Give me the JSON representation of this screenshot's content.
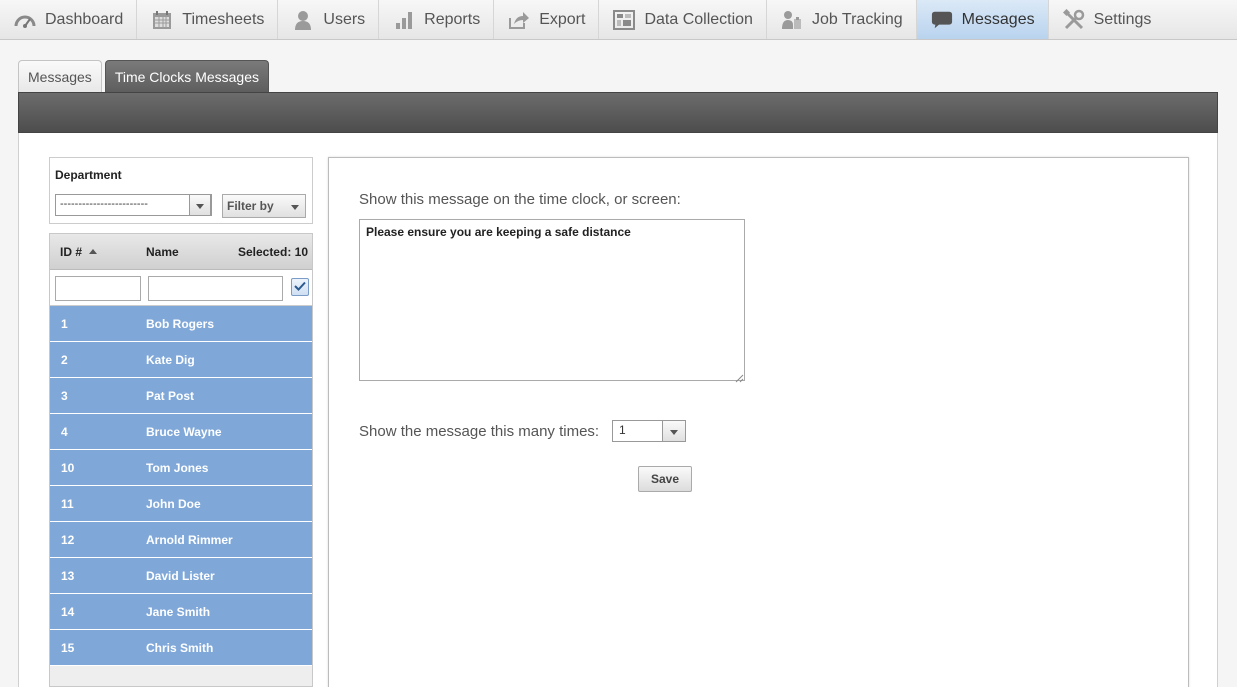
{
  "nav": [
    {
      "label": "Dashboard",
      "icon": "dashboard-icon"
    },
    {
      "label": "Timesheets",
      "icon": "calendar-icon"
    },
    {
      "label": "Users",
      "icon": "user-icon"
    },
    {
      "label": "Reports",
      "icon": "bar-chart-icon"
    },
    {
      "label": "Export",
      "icon": "export-icon"
    },
    {
      "label": "Data Collection",
      "icon": "grid-icon"
    },
    {
      "label": "Job Tracking",
      "icon": "job-tracking-icon"
    },
    {
      "label": "Messages",
      "icon": "chat-bubble-icon",
      "active": true
    },
    {
      "label": "Settings",
      "icon": "tools-icon"
    }
  ],
  "tabs": [
    {
      "label": "Messages"
    },
    {
      "label": "Time Clocks Messages",
      "active": true
    }
  ],
  "department": {
    "label": "Department",
    "selected": "------------------------",
    "filter_label": "Filter by"
  },
  "users_table": {
    "col_id": "ID #",
    "col_name": "Name",
    "selected_text": "Selected: 10",
    "rows": [
      {
        "id": "1",
        "name": "Bob Rogers"
      },
      {
        "id": "2",
        "name": "Kate Dig"
      },
      {
        "id": "3",
        "name": "Pat Post"
      },
      {
        "id": "4",
        "name": "Bruce Wayne"
      },
      {
        "id": "10",
        "name": "Tom Jones"
      },
      {
        "id": "11",
        "name": "John Doe"
      },
      {
        "id": "12",
        "name": "Arnold Rimmer"
      },
      {
        "id": "13",
        "name": "David Lister"
      },
      {
        "id": "14",
        "name": "Jane Smith"
      },
      {
        "id": "15",
        "name": "Chris Smith"
      }
    ]
  },
  "message": {
    "label": "Show this message on the time clock, or screen:",
    "text": "Please ensure you are keeping a safe distance",
    "times_label": "Show the message this many times:",
    "times_value": "1",
    "save_label": "Save"
  },
  "colors": {
    "selected_row": "#7fa8d9",
    "active_nav": "#b9d3ee",
    "dark_bar": "#5a5a5a"
  }
}
